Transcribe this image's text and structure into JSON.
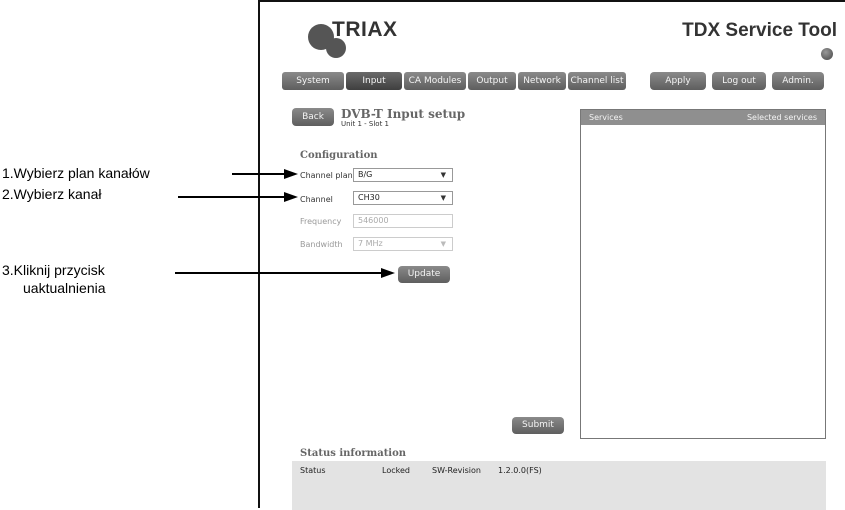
{
  "header": {
    "logo": "TRIAX",
    "app_title": "TDX Service Tool"
  },
  "nav": [
    "System",
    "Input",
    "CA Modules",
    "Output",
    "Network",
    "Channel list"
  ],
  "actions": {
    "apply": "Apply",
    "logout": "Log out",
    "admin": "Admin."
  },
  "page": {
    "back": "Back",
    "title": "DVB-T Input setup",
    "subtitle": "Unit 1 - Slot 1"
  },
  "config": {
    "section": "Configuration",
    "channel_plan_label": "Channel plan",
    "channel_plan_value": "B/G",
    "channel_label": "Channel",
    "channel_value": "CH30",
    "frequency_label": "Frequency",
    "frequency_value": "546000",
    "bandwidth_label": "Bandwidth",
    "bandwidth_value": "7 MHz",
    "update": "Update"
  },
  "services": {
    "services_header": "Services",
    "selected_header": "Selected services",
    "submit": "Submit"
  },
  "status": {
    "title": "Status information",
    "status_label": "Status",
    "status_value": "Locked",
    "sw_label": "SW-Revision",
    "sw_value": "1.2.0.0(FS)"
  },
  "annotations": {
    "step1": "1.Wybierz plan kanałów",
    "step2": "2.Wybierz kanał",
    "step3_line1": "3.Kliknij przycisk",
    "step3_line2": "uaktualnienia"
  }
}
